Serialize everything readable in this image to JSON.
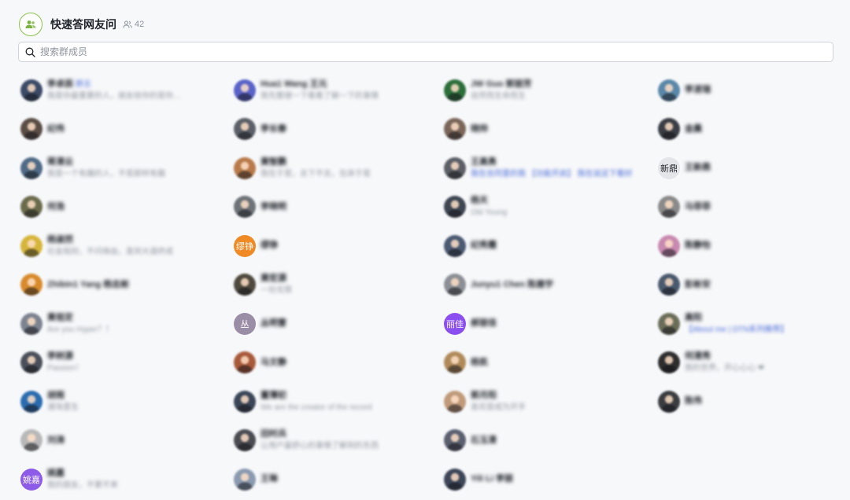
{
  "header": {
    "title": "快速答网友问",
    "member_count": "42"
  },
  "search": {
    "placeholder": "搜索群成员"
  },
  "columns": [
    [
      {
        "name": "李卓辰",
        "tag": "群主",
        "sub": "我是你最重要的人，朋友给你的是你…",
        "color": "#3b4a66"
      },
      {
        "name": "纪伟",
        "sub": "",
        "color": "#5a4d45"
      },
      {
        "name": "蒋清云",
        "sub": "我是一个有趣的人，不是那样有趣",
        "color": "#4f6a86"
      },
      {
        "name": "何浩",
        "sub": "",
        "color": "#6b6b4c"
      },
      {
        "name": "杨淑然",
        "sub": "社会规则，不问缘由，直到大道终成",
        "color": "#d6b53b"
      },
      {
        "name": "Zhibin1 Yang 杨志彬",
        "sub": "",
        "color": "#d88a2c"
      },
      {
        "name": "黄祖定",
        "sub": "Are you Hyper？！",
        "color": "#7d8490"
      },
      {
        "name": "李树源",
        "sub": "Passion！",
        "color": "#4a4f5a"
      },
      {
        "name": "胡雨",
        "sub": "潮海里生",
        "color": "#2a6cb0"
      },
      {
        "name": "刘涛",
        "sub": "",
        "color": "#b8b8b8"
      },
      {
        "name": "姚嘉",
        "sub": "我的朋友，不要不来",
        "avatar_text": "姚嘉",
        "color": "#8e5be8"
      }
    ],
    [
      {
        "name": "Hua1 Wang 王元",
        "sub": "我先整理一下看看了解一下的事情",
        "color": "#5a63c8"
      },
      {
        "name": "李长春",
        "sub": "",
        "color": "#5b6068"
      },
      {
        "name": "黄智鹏",
        "sub": "我在于是，去下不去，在床于是",
        "color": "#b87a4a"
      },
      {
        "name": "李晓明",
        "sub": "",
        "color": "#6e7378"
      },
      {
        "name": "缪铮",
        "sub": "",
        "avatar_text": "缪铮",
        "color": "#f08a24"
      },
      {
        "name": "黄宏源",
        "sub": "一份无限",
        "color": "#4f4a3e"
      },
      {
        "name": "丛明雷",
        "sub": "",
        "avatar_text": "丛",
        "color": "#9a8ea6"
      },
      {
        "name": "马文静",
        "sub": "",
        "color": "#a85a3a"
      },
      {
        "name": "董薄初",
        "sub": "We are the creator of the record",
        "color": "#3a4658"
      },
      {
        "name": "田时兵",
        "sub": "让用户最舒心的事情了解到的东西",
        "color": "#4a4c52"
      },
      {
        "name": "王琳",
        "sub": "",
        "color": "#8a9ab0"
      }
    ],
    [
      {
        "name": "JW Guo 郭丽芳",
        "sub": "自然而生命而生",
        "color": "#2c6e3a"
      },
      {
        "name": "晓帅",
        "sub": "",
        "color": "#7a6658"
      },
      {
        "name": "王高勇",
        "sub": "我在合同里的我 【功能开启】 我在说这下看好",
        "sub_link": true,
        "color": "#5b5f66"
      },
      {
        "name": "杨天",
        "sub": "Old Young",
        "color": "#3e4652"
      },
      {
        "name": "纪秀霞",
        "sub": "",
        "color": "#4b5a72"
      },
      {
        "name": "Junyu1 Chen 陈建宇",
        "sub": "",
        "color": "#8c9096"
      },
      {
        "name": "郝丽佳",
        "sub": "",
        "avatar_text": "丽佳",
        "color": "#8b4ff0"
      },
      {
        "name": "杨凯",
        "sub": "",
        "color": "#b08a5a"
      },
      {
        "name": "郭月阳",
        "sub": "喜欢是成为开手",
        "color": "#c09a7a"
      },
      {
        "name": "石玉清",
        "sub": "",
        "color": "#5a6070"
      },
      {
        "name": "Yili Li 李丽",
        "sub": "",
        "color": "#3c4658"
      }
    ],
    [
      {
        "name": "李凌瑞",
        "sub": "",
        "color": "#5a88a8"
      },
      {
        "name": "金晨",
        "sub": "",
        "color": "#3a3e44"
      },
      {
        "name": "王新鼎",
        "sub": "",
        "avatar_text": "新鼎",
        "avatar_light": true,
        "color": "#e3e5e8"
      },
      {
        "name": "马菲菲",
        "sub": "",
        "color": "#8a8a8a"
      },
      {
        "name": "陈静怡",
        "sub": "",
        "color": "#c88ab0"
      },
      {
        "name": "彭彬安",
        "sub": "",
        "color": "#4a5a6e"
      },
      {
        "name": "高阳",
        "sub": "【About me | DTN系列推荐】",
        "sub_link": true,
        "color": "#6a6e58"
      },
      {
        "name": "何清秀",
        "sub": "我的世界，开心心心 ❤",
        "color": "#2e2e2e"
      },
      {
        "name": "陈伟",
        "sub": "",
        "color": "#3a3c40"
      }
    ]
  ]
}
